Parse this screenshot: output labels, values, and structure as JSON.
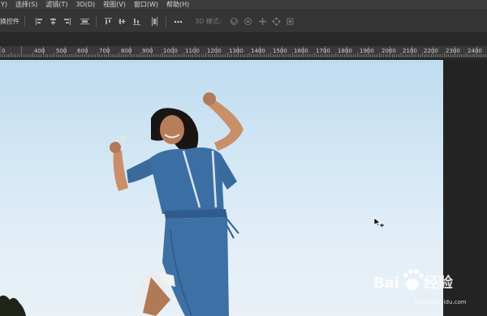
{
  "menu": {
    "items": [
      "Y)",
      "选择(S)",
      "滤镜(T)",
      "3D(D)",
      "视图(V)",
      "窗口(W)",
      "帮助(H)"
    ]
  },
  "options_bar": {
    "label": "换控件",
    "mode_3d": "3D 模式:",
    "icons": [
      "align-left-icon",
      "align-hcenter-icon",
      "align-right-icon",
      "distribute-icon",
      "align-top-icon",
      "align-vcenter-icon",
      "align-bottom-icon",
      "distribute-v-icon",
      "more-icon",
      "rotate-3d-icon",
      "roll-3d-icon",
      "pan-3d-icon",
      "slide-3d-icon",
      "scale-3d-icon"
    ]
  },
  "ruler": {
    "labels": [
      "0",
      "400",
      "500",
      "600",
      "700",
      "800",
      "900",
      "1000",
      "1100",
      "1200",
      "1300",
      "1400",
      "1500",
      "1600",
      "1700",
      "1800",
      "1900",
      "2000",
      "2100",
      "2200",
      "2300",
      "2400"
    ]
  },
  "watermark": {
    "text": "Bai",
    "text2": "经验",
    "sub": "jingyan.baidu.com"
  },
  "colors": {
    "menubar": "#3b3b3b",
    "optbar": "#353535",
    "workspace": "#282828",
    "sky_top": "#bfdcf0",
    "jumpsuit": "#3b6fa3"
  }
}
